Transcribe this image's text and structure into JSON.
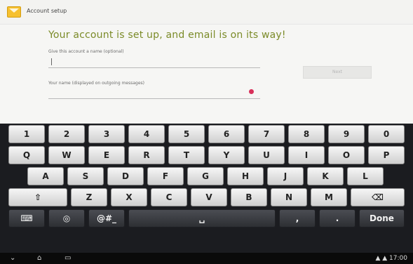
{
  "app": {
    "title": "Account setup",
    "heading": "Your account is set up, and email is on its way!"
  },
  "form": {
    "account_label": "Give this account a name (optional)",
    "name_label": "Your name (displayed on outgoing messages)",
    "next_label": "Next"
  },
  "keyboard": {
    "number_row": [
      "1",
      "2",
      "3",
      "4",
      "5",
      "6",
      "7",
      "8",
      "9",
      "0"
    ],
    "q_row": [
      "Q",
      "W",
      "E",
      "R",
      "T",
      "Y",
      "U",
      "I",
      "O",
      "P"
    ],
    "a_row": [
      "A",
      "S",
      "D",
      "F",
      "G",
      "H",
      "J",
      "K",
      "L"
    ],
    "z_row": [
      "Z",
      "X",
      "C",
      "V",
      "B",
      "N",
      "M"
    ],
    "shift_label": "⇧",
    "backspace_label": "⌫",
    "symbols_label": "@#_",
    "comma_label": ",",
    "period_label": ".",
    "done_label": "Done"
  },
  "system": {
    "status": "▲ ▲ 17:00"
  },
  "colors": {
    "heading": "#7b8b28",
    "error_dot": "#d8305a",
    "keyboard_bg": "#1b1c20",
    "key_light": "#e7e7e7",
    "key_dark": "#3a3b40"
  }
}
